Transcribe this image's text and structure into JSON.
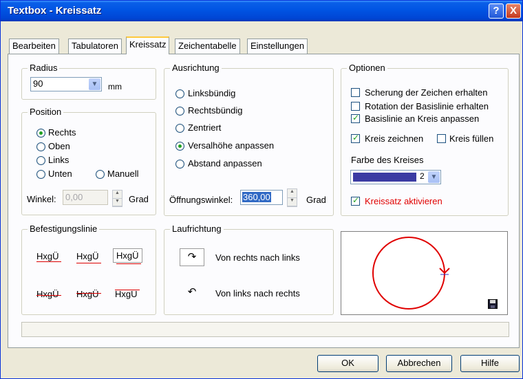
{
  "window": {
    "title": "Textbox - Kreissatz"
  },
  "title_buttons": {
    "help": "?",
    "close": "X"
  },
  "tabs": [
    "Bearbeiten",
    "Tabulatoren",
    "Kreissatz",
    "Zeichentabelle",
    "Einstellungen"
  ],
  "radius": {
    "legend": "Radius",
    "value": "90",
    "unit": "mm"
  },
  "position": {
    "legend": "Position",
    "options": [
      "Rechts",
      "Oben",
      "Links",
      "Unten",
      "Manuell"
    ],
    "selected": "Rechts",
    "angle_label": "Winkel:",
    "angle_value": "0,00",
    "angle_unit": "Grad"
  },
  "ausrichtung": {
    "legend": "Ausrichtung",
    "options": [
      "Linksbündig",
      "Rechtsbündig",
      "Zentriert",
      "Versalhöhe anpassen",
      "Abstand anpassen"
    ],
    "selected": "Versalhöhe anpassen",
    "opening_label": "Öffnungswinkel:",
    "opening_value": "360,00",
    "opening_unit": "Grad"
  },
  "optionen": {
    "legend": "Optionen",
    "checks": [
      {
        "label": "Scherung der Zeichen erhalten",
        "checked": false
      },
      {
        "label": "Rotation der Basislinie erhalten",
        "checked": false
      },
      {
        "label": "Basislinie an Kreis anpassen",
        "checked": true
      },
      {
        "label": "Kreis zeichnen",
        "checked": true
      },
      {
        "label": "Kreis füllen",
        "checked": false
      }
    ],
    "color_label": "Farbe des Kreises",
    "color_index": "2",
    "color_swatch": "#3b3ba3",
    "activate_label": "Kreissatz aktivieren",
    "activate_checked": true,
    "activate_color": "#e00000"
  },
  "befestigung": {
    "legend": "Befestigungslinie",
    "samples": [
      "HxgÜ",
      "HxgÜ",
      "HxgÜ",
      "HxgÜ",
      "HxgÜ",
      "HxgÜ"
    ]
  },
  "laufrichtung": {
    "legend": "Laufrichtung",
    "options": [
      "Von rechts nach links",
      "Von links nach rechts"
    ],
    "icons": [
      "↷",
      "↶"
    ]
  },
  "preview": {
    "circle_color": "#e00000",
    "save_icon": "floppy-disk-icon"
  },
  "buttons": {
    "ok": "OK",
    "cancel": "Abbrechen",
    "help": "Hilfe"
  }
}
